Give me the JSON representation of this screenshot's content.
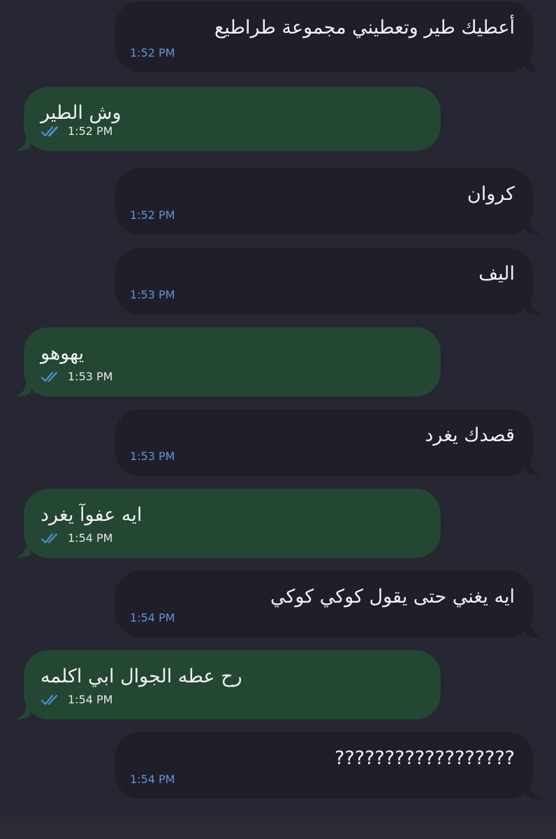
{
  "messages": [
    {
      "direction": "in",
      "text": "أعطيك طير وتعطيني مجموعة طراطيع",
      "time": "1:52 PM"
    },
    {
      "direction": "out",
      "text": "وش الطير",
      "time": "1:52 PM",
      "read": true
    },
    {
      "direction": "in",
      "text": "كروان",
      "time": "1:52 PM"
    },
    {
      "direction": "in",
      "text": "اليف",
      "time": "1:53 PM"
    },
    {
      "direction": "out",
      "text": "يهوهو",
      "time": "1:53 PM",
      "read": true
    },
    {
      "direction": "in",
      "text": "قصدك يغرد",
      "time": "1:53 PM"
    },
    {
      "direction": "out",
      "text": "ايه عفوآ يغرد",
      "time": "1:54 PM",
      "read": true
    },
    {
      "direction": "in",
      "text": "ايه يغني حتى يقول كوكي كوكي",
      "time": "1:54 PM"
    },
    {
      "direction": "out",
      "text": "رح عطه الجوال ابي اكلمه",
      "time": "1:54 PM",
      "read": true
    },
    {
      "direction": "in",
      "text": "??????????????????",
      "time": "1:54 PM"
    }
  ],
  "colors": {
    "background": "#272733",
    "incoming_bubble": "#1f1e29",
    "outgoing_bubble": "#244733",
    "incoming_time": "#5d97d8",
    "read_ticks": "#4f8fdc"
  },
  "icons": {
    "read_receipt": "double-check-icon"
  }
}
